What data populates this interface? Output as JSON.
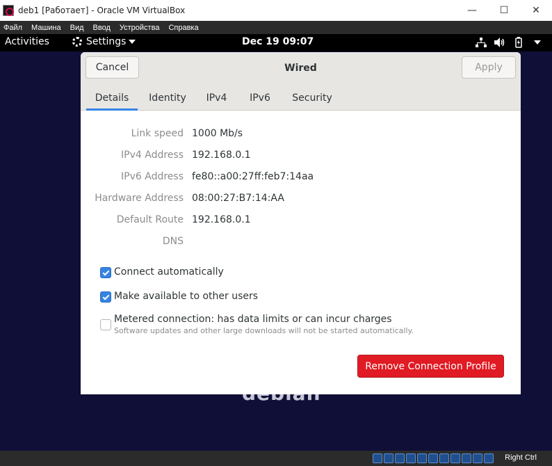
{
  "host_window": {
    "title": "deb1 [Работает] - Oracle VM VirtualBox",
    "minimize_glyph": "—",
    "maximize_glyph": "☐",
    "close_glyph": "✕"
  },
  "vb_menu": [
    "Файл",
    "Машина",
    "Вид",
    "Ввод",
    "Устройства",
    "Справка"
  ],
  "gnome_topbar": {
    "activities": "Activities",
    "app_menu": "Settings",
    "clock": "Dec 19  09:07"
  },
  "background": {
    "logo_text": "debian"
  },
  "dialog": {
    "cancel_label": "Cancel",
    "title": "Wired",
    "apply_label": "Apply",
    "tabs": [
      {
        "label": "Details",
        "active": true
      },
      {
        "label": "Identity",
        "active": false
      },
      {
        "label": "IPv4",
        "active": false
      },
      {
        "label": "IPv6",
        "active": false
      },
      {
        "label": "Security",
        "active": false
      }
    ],
    "details": [
      {
        "label": "Link speed",
        "value": "1000 Mb/s"
      },
      {
        "label": "IPv4 Address",
        "value": "192.168.0.1"
      },
      {
        "label": "IPv6 Address",
        "value": "fe80::a00:27ff:feb7:14aa"
      },
      {
        "label": "Hardware Address",
        "value": "08:00:27:B7:14:AA"
      },
      {
        "label": "Default Route",
        "value": "192.168.0.1"
      },
      {
        "label": "DNS",
        "value": ""
      }
    ],
    "checkboxes": [
      {
        "label": "Connect automatically",
        "checked": true,
        "sublabel": ""
      },
      {
        "label": "Make available to other users",
        "checked": true,
        "sublabel": ""
      },
      {
        "label": "Metered connection: has data limits or can incur charges",
        "checked": false,
        "sublabel": "Software updates and other large downloads will not be started automatically."
      }
    ],
    "remove_label": "Remove Connection Profile"
  },
  "vb_status": {
    "host_key": "Right Ctrl"
  },
  "colors": {
    "accent": "#3584e4",
    "destructive": "#e01b24",
    "desktop_bg": "#0f0f38"
  }
}
